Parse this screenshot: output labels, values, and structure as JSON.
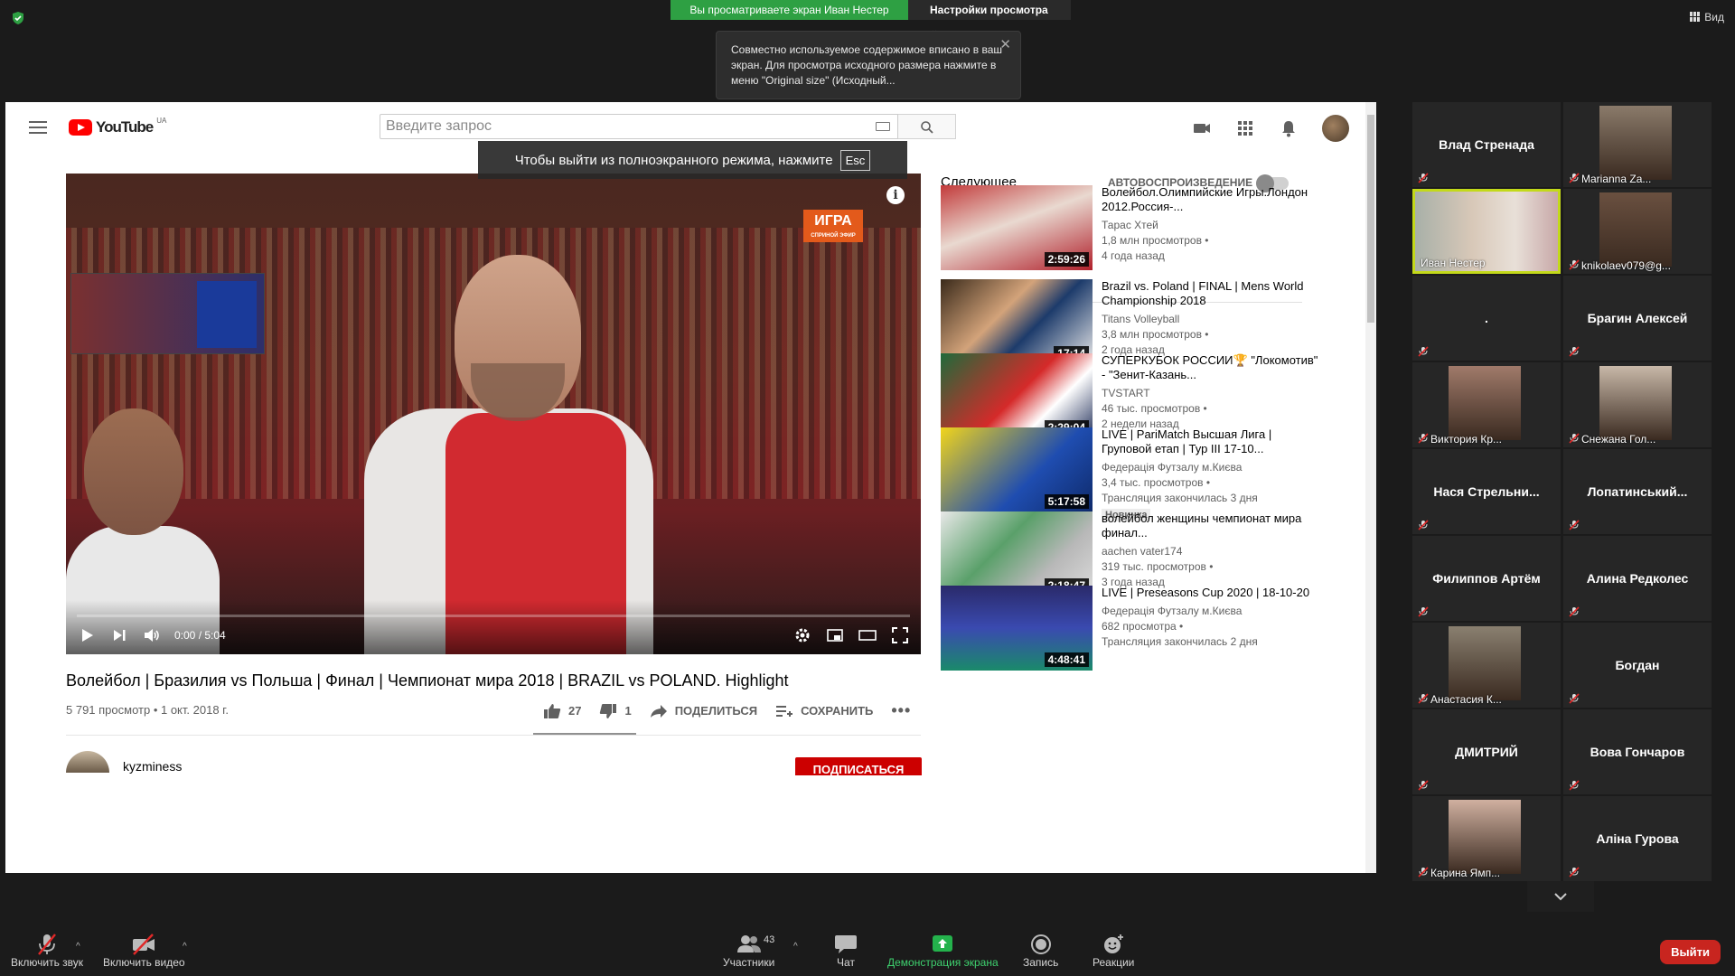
{
  "zoom": {
    "share_banner": "Вы просматриваете экран Иван Нестер",
    "view_settings": "Настройки просмотра",
    "view_button": "Вид",
    "tooltip": "Совместно используемое содержимое вписано в ваш экран. Для просмотра исходного размера нажмите в меню \"Original size\" (Исходный..."
  },
  "youtube": {
    "logo": "YouTube",
    "region": "UA",
    "search_placeholder": "Введите запрос",
    "fullscreen_tip": "Чтобы выйти из полноэкранного режима, нажмите",
    "esc_key": "Esc",
    "badge_top": "ИГРА",
    "badge_bottom": "СПРИНОЙ ЭФИР",
    "timecode": "0:00 / 5:04",
    "progress": 0.0,
    "video_title": "Волейбол | Бразилия vs Польша | Финал | Чемпионат мира 2018 | BRAZIL vs POLAND. Highlight",
    "video_meta": "5 791 просмотр • 1 окт. 2018 г.",
    "likes": "27",
    "dislikes": "1",
    "share_label": "ПОДЕЛИТЬСЯ",
    "save_label": "СОХРАНИТЬ",
    "channel": "kyzminess",
    "subscribe": "ПОДПИСАТЬСЯ",
    "upnext_label": "Следующее",
    "autoplay_label": "АВТОВОСПРОИЗВЕДЕНИЕ",
    "recommendations": [
      {
        "title": "Волейбол.Олимпийские Игры.Лондон 2012.Россия-...",
        "channel": "Тарас Хтей",
        "views": "1,8 млн просмотров •",
        "ago": "4 года назад",
        "duration": "2:59:26",
        "badge": ""
      },
      {
        "title": "Brazil vs. Poland | FINAL | Mens World Championship 2018",
        "channel": "Titans Volleyball",
        "views": "3,8 млн просмотров •",
        "ago": "2 года назад",
        "duration": "17:14",
        "badge": ""
      },
      {
        "title": "СУПЕРКУБОК РОССИИ🏆 \"Локомотив\" - \"Зенит-Казань...",
        "channel": "TVSTART",
        "views": "46 тыс. просмотров •",
        "ago": "2 недели назад",
        "duration": "2:29:04",
        "badge": ""
      },
      {
        "title": "LIVE | PariMatch Высшая Лига | Груповой етап | Тур ІІІ 17-10...",
        "channel": "Федерація Футзалу м.Києва",
        "views": "3,4 тыс. просмотров •",
        "ago": "Трансляция закончилась 3 дня",
        "duration": "5:17:58",
        "badge": "Новинка"
      },
      {
        "title": "волейбол женщины чемпионат мира финал...",
        "channel": "aachen vater174",
        "views": "319 тыс. просмотров •",
        "ago": "3 года назад",
        "duration": "2:18:47",
        "badge": ""
      },
      {
        "title": "LIVE | Preseasons Cup 2020 | 18-10-20",
        "channel": "Федерація Футзалу м.Києва",
        "views": "682 просмотра •",
        "ago": "Трансляция закончилась 2 дня",
        "duration": "4:48:41",
        "badge": ""
      }
    ]
  },
  "participants": [
    {
      "name": "Влад Стренада",
      "type": "name"
    },
    {
      "name": "Marianna Za...",
      "type": "photo"
    },
    {
      "name": "Иван Нестер",
      "type": "full",
      "active": true
    },
    {
      "name": "knikolaev079@g...",
      "type": "photo"
    },
    {
      "name": ".",
      "type": "name"
    },
    {
      "name": "Брагин Алексей",
      "type": "name"
    },
    {
      "name": "Виктория Кр...",
      "type": "photo"
    },
    {
      "name": "Снежана Гол...",
      "type": "photo"
    },
    {
      "name": "Нася  Стрельни...",
      "type": "name"
    },
    {
      "name": "Лопатинський...",
      "type": "name"
    },
    {
      "name": "Филиппов Артём",
      "type": "name"
    },
    {
      "name": "Алина Редколес",
      "type": "name"
    },
    {
      "name": "Анастасия К...",
      "type": "photo"
    },
    {
      "name": "Богдан",
      "type": "name"
    },
    {
      "name": "ДМИТРИЙ",
      "type": "name"
    },
    {
      "name": "Вова Гончаров",
      "type": "name"
    },
    {
      "name": "Карина Ямп...",
      "type": "photo"
    },
    {
      "name": "Аліна Гурова",
      "type": "name"
    }
  ],
  "toolbar": {
    "mute": "Включить звук",
    "video": "Включить видео",
    "participants": "Участники",
    "participants_count": "43",
    "chat": "Чат",
    "share": "Демонстрация экрана",
    "record": "Запись",
    "reactions": "Реакции",
    "leave": "Выйти"
  },
  "colors": {
    "zoom_green": "#2ea043",
    "active_border": "#c3d91a",
    "yt_red": "#ff0000",
    "leave_red": "#c8251f"
  }
}
